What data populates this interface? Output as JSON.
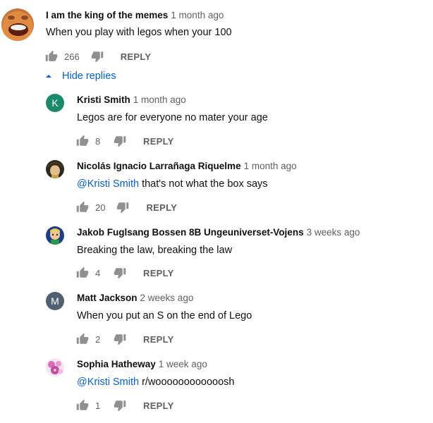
{
  "colors": {
    "link": "#065fd4",
    "meta": "#606060",
    "text": "#0f0f0f"
  },
  "top_comment": {
    "author": "I am the king of the memes",
    "time": "1 month ago",
    "text": "When you play with legos when your 100",
    "likes": "266",
    "reply_label": "REPLY",
    "avatar_icon": "meme-face-avatar"
  },
  "hide_replies": {
    "label": "Hide replies",
    "icon": "chevron-up-icon"
  },
  "replies": [
    {
      "author": "Kristi Smith",
      "time": "1 month ago",
      "mention": "",
      "text": "Legos are for everyone no mater your age",
      "likes": "8",
      "reply_label": "REPLY",
      "avatar_letter": "K",
      "avatar_color": "#1b8a6b"
    },
    {
      "author": "Nicolás Ignacio Larrañaga Riquelme",
      "time": "1 month ago",
      "mention": "@Kristi Smith",
      "text": "that's not what the box says",
      "likes": "20",
      "reply_label": "REPLY",
      "avatar_icon": "anime-avatar"
    },
    {
      "author": "Jakob Fuglsang Bossen 8B Ungeuniverset-Vojens",
      "time": "3 weeks ago",
      "mention": "",
      "text": "Breaking the law, breaking the law",
      "likes": "4",
      "reply_label": "REPLY",
      "avatar_icon": "cartoon-avatar"
    },
    {
      "author": "Matt Jackson",
      "time": "2 weeks ago",
      "mention": "",
      "text": "When you put an S on the end of Lego",
      "likes": "2",
      "reply_label": "REPLY",
      "avatar_letter": "M",
      "avatar_color": "#4f6170"
    },
    {
      "author": "Sophia Hatheway",
      "time": "1 week ago",
      "mention": "@Kristi Smith",
      "text": "r/woooooooooooosh",
      "likes": "1",
      "reply_label": "REPLY",
      "avatar_icon": "flowers-avatar"
    }
  ]
}
